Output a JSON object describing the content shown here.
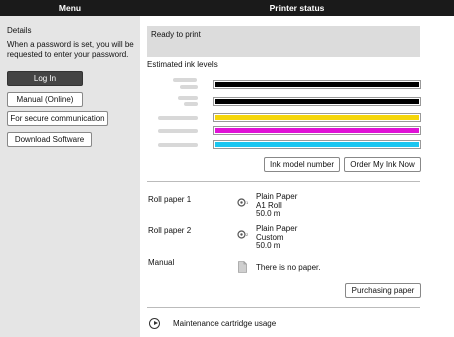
{
  "header": {
    "menu_title": "Menu",
    "status_title": "Printer status"
  },
  "sidebar": {
    "details_title": "Details",
    "details_text": "When a password is set, you will be requested to enter your password.",
    "login_button": "Log In",
    "manual_button": "Manual (Online)",
    "secure_button": "For secure communication",
    "download_button": "Download Software"
  },
  "status": {
    "ready_text": "Ready to print",
    "estimated_ink_title": "Estimated ink levels"
  },
  "inks": [
    {
      "color": "#000000",
      "level": 1.0
    },
    {
      "color": "#000000",
      "level": 1.0
    },
    {
      "color": "#f5d60a",
      "level": 1.0
    },
    {
      "color": "#e012d6",
      "level": 1.0
    },
    {
      "color": "#1bc6f0",
      "level": 1.0
    }
  ],
  "ink_buttons": {
    "model_number": "Ink model number",
    "order": "Order My Ink Now"
  },
  "paper": {
    "roll1_label": "Roll paper 1",
    "roll1_type": "Plain Paper",
    "roll1_size": "A1 Roll",
    "roll1_length": "50.0 m",
    "roll2_label": "Roll paper 2",
    "roll2_type": "Plain Paper",
    "roll2_size": "Custom",
    "roll2_length": "50.0 m",
    "manual_label": "Manual",
    "manual_status": "There is no paper.",
    "purchase_button": "Purchasing paper"
  },
  "maintenance": {
    "label": "Maintenance cartridge usage"
  }
}
